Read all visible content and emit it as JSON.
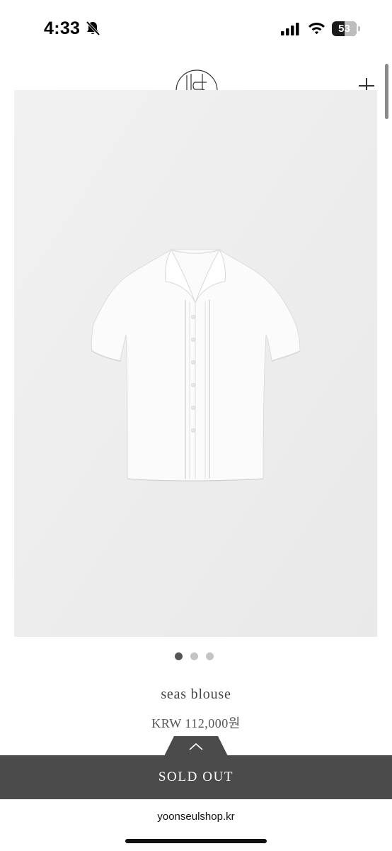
{
  "status_bar": {
    "time": "4:33",
    "battery_level": "53",
    "icons": [
      "bell-slash-icon",
      "cellular-signal-icon",
      "wifi-icon",
      "battery-icon"
    ]
  },
  "header": {
    "logo_icon": "brand-monogram-logo",
    "menu_icon": "plus-icon"
  },
  "product": {
    "name": "seas blouse",
    "price": "KRW 112,000원",
    "image_icon": "white-blouse-photo",
    "carousel": {
      "count": 3,
      "active_index": 0
    }
  },
  "purchase": {
    "status_label": "SOLD OUT",
    "expand_icon": "chevron-up-icon"
  },
  "browser": {
    "url": "yoonseulshop.kr"
  },
  "colors": {
    "background": "#ffffff",
    "image_background": "#eeeeee",
    "sold_out_bar": "#4b4b4b",
    "dot_active": "#555555",
    "dot_inactive": "#c4c4c4"
  }
}
